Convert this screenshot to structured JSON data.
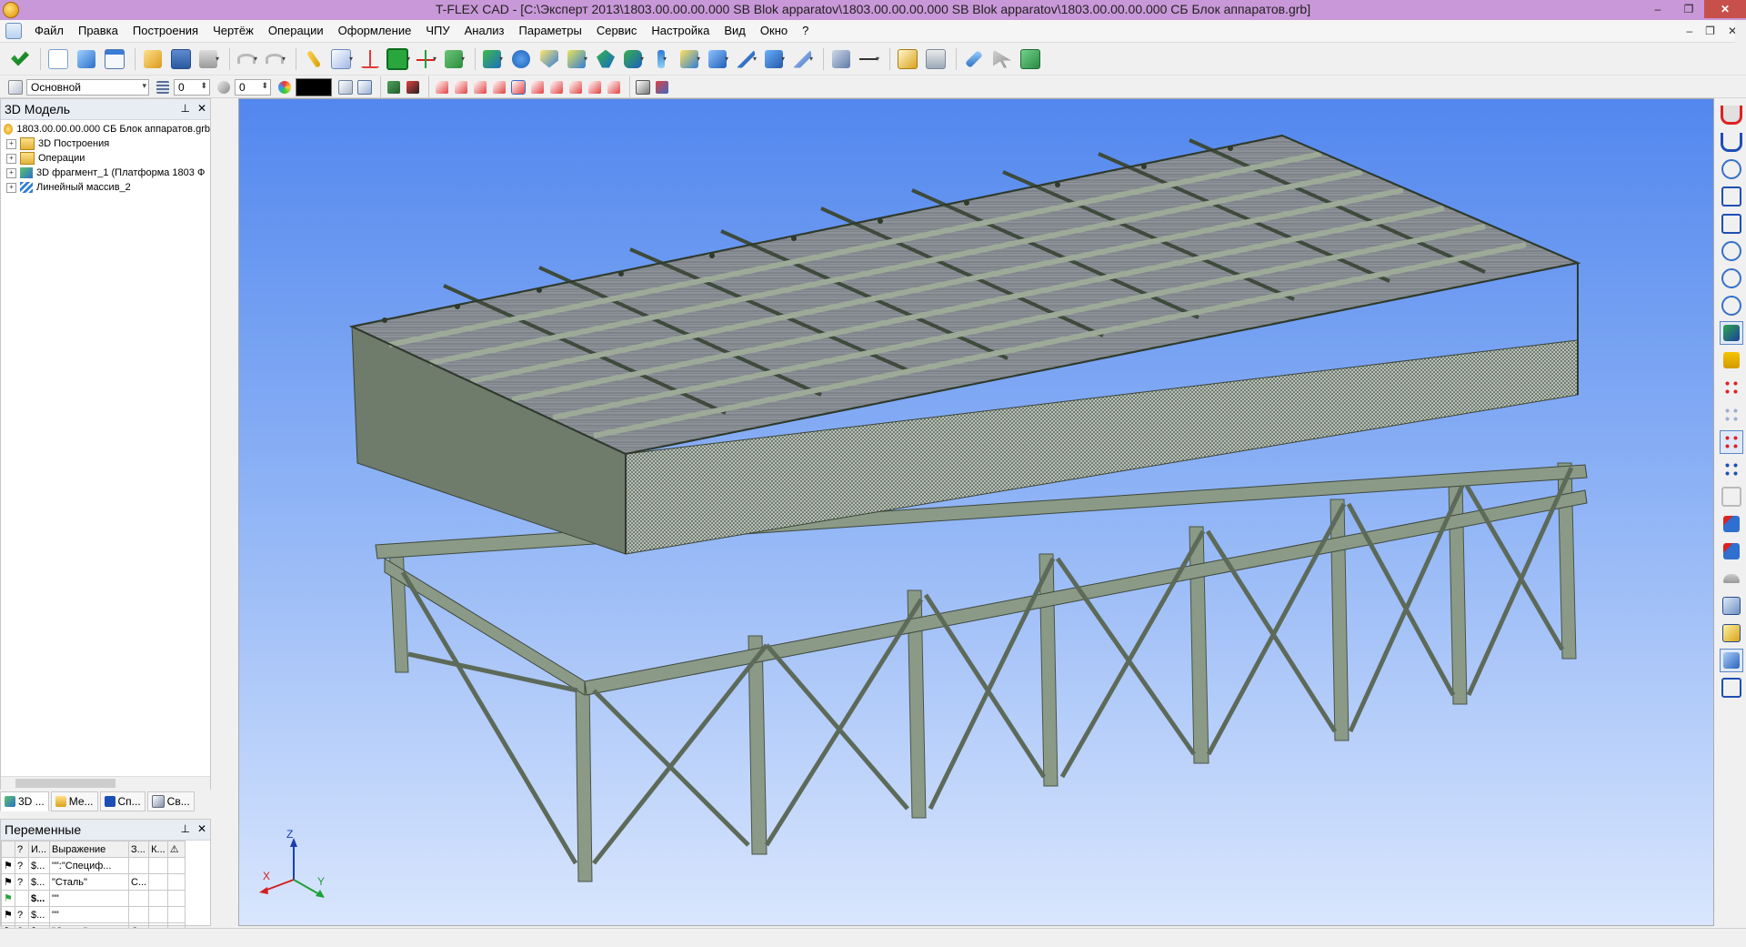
{
  "window": {
    "title": "T-FLEX CAD - [C:\\Эксперт 2013\\1803.00.00.00.000 SB Blok apparatov\\1803.00.00.00.000 SB Blok apparatov\\1803.00.00.00.000 СБ Блок аппаратов.grb]",
    "min": "–",
    "max": "❐",
    "close": "✕"
  },
  "menu": [
    "Файл",
    "Правка",
    "Построения",
    "Чертёж",
    "Операции",
    "Оформление",
    "ЧПУ",
    "Анализ",
    "Параметры",
    "Сервис",
    "Настройка",
    "Вид",
    "Окно",
    "?"
  ],
  "mdi": {
    "min": "–",
    "restore": "❐",
    "close": "✕"
  },
  "toolbar2": {
    "layer": "Основной",
    "level": "0",
    "priority": "0",
    "color": "#000000"
  },
  "tree_panel": {
    "title": "3D Модель",
    "pin": "⊥",
    "close": "✕",
    "root": "1803.00.00.00.000 СБ Блок аппаратов.grb",
    "items": [
      "3D Построения",
      "Операции",
      "3D фрагмент_1 (Платформа 1803 Ф",
      "Линейный массив_2"
    ]
  },
  "tabs": [
    "3D ...",
    "Ме...",
    "Сп...",
    "Св..."
  ],
  "vars_panel": {
    "title": "Переменные",
    "pin": "⊥",
    "close": "✕",
    "headers": [
      "",
      "?",
      "И...",
      "Выражение",
      "З...",
      "К...",
      "⚠"
    ],
    "rows": [
      {
        "q": "?",
        "name": "$...",
        "expr": "\"\":\"Специф...",
        "z": "",
        "k": ""
      },
      {
        "q": "?",
        "name": "$...",
        "expr": "\"Сталь\"",
        "z": "С...",
        "k": ""
      },
      {
        "q": "",
        "name": "$...",
        "expr": "\"\"",
        "z": "",
        "k": ""
      },
      {
        "q": "?",
        "name": "$...",
        "expr": "\"\"",
        "z": "",
        "k": ""
      },
      {
        "q": "?",
        "name": "$...",
        "expr": "\"Сталь\"",
        "z": "С...",
        "k": ""
      }
    ]
  },
  "triad": {
    "x": "X",
    "y": "Y",
    "z": "Z"
  },
  "colors": {
    "title": "#c998d8",
    "viewport_top": "#5287ee",
    "viewport_bottom": "#d9e6fd",
    "steel": "#8a9a86",
    "panel": "#8b8f95"
  },
  "icons": {
    "toolbar1": [
      "check-icon",
      "new-doc-icon",
      "cube-icon",
      "window-icon",
      "open-icon",
      "save-icon",
      "print-icon",
      "undo-icon",
      "redo-icon",
      "pencil-icon",
      "view-icon",
      "axis-icon",
      "green-tool-icon",
      "coord-icon",
      "box-icon",
      "extrude-icon",
      "rotate-icon",
      "shield-icon",
      "loft-icon",
      "sweep-icon",
      "pipe-icon",
      "shell-icon",
      "blend-icon",
      "boolean-icon",
      "cut-icon",
      "section-icon",
      "chamfer-icon",
      "measure-icon",
      "dimension-icon",
      "report-icon",
      "calc-icon",
      "link-icon",
      "select-icon",
      "group-icon"
    ],
    "right": [
      "magnet-icon",
      "magnet-check-icon",
      "zoom-window-icon",
      "zoom-extents-icon",
      "fit-icon",
      "zoom-in-icon",
      "zoom-out-icon",
      "zoom-prev-icon",
      "snap-icon",
      "label-icon",
      "node-icon",
      "node2-icon",
      "node-active-icon",
      "node3-icon",
      "copy-icon",
      "check-cube-icon",
      "check-cube2-icon",
      "hat-icon",
      "cube-front-icon",
      "cube-iso-icon",
      "cube-render-icon",
      "frame-icon"
    ]
  }
}
